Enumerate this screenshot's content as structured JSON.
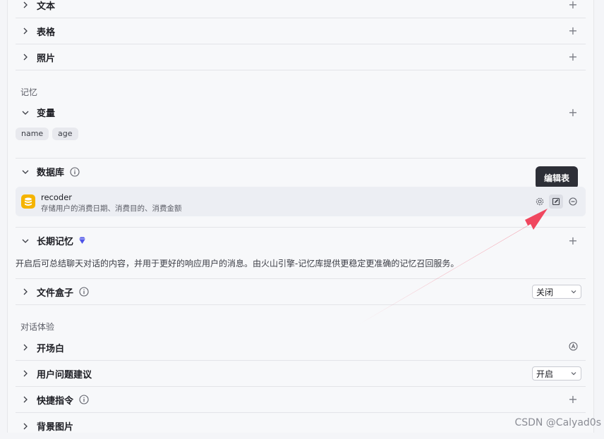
{
  "sections": {
    "text": "文本",
    "table": "表格",
    "photo": "照片",
    "memory_title": "记忆",
    "variables": "变量",
    "variable_tags": [
      "name",
      "age"
    ],
    "database": "数据库",
    "long_memory": "长期记忆",
    "long_memory_desc": "开启后可总结聊天对话的内容，并用于更好的响应用户的消息。由火山引擎-记忆库提供更稳定更准确的记忆召回服务。",
    "file_box": "文件盒子",
    "file_box_value": "关闭",
    "dialog_title": "对话体验",
    "opening": "开场白",
    "suggestions": "用户问题建议",
    "suggestions_value": "开启",
    "shortcuts": "快捷指令",
    "background": "背景图片"
  },
  "db_item": {
    "name": "recoder",
    "description": "存储用户的消费日期、消费目的、消费金额"
  },
  "tooltip": "编辑表",
  "watermark": "CSDN @Calyad0s",
  "colors": {
    "arrow": "#f0475f",
    "db_icon": "#f5b400",
    "diamond": "#4d53e8"
  }
}
